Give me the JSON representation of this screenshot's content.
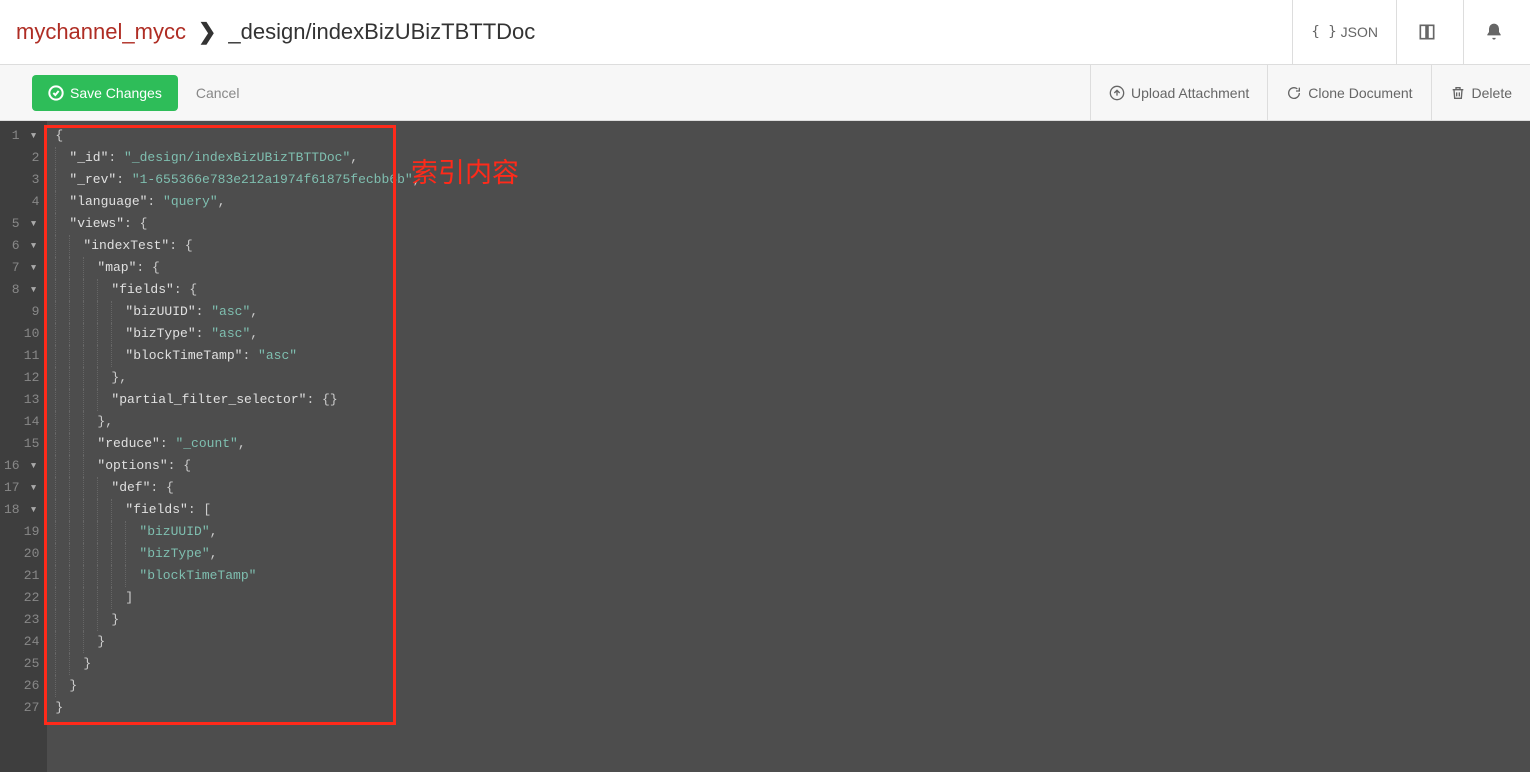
{
  "header": {
    "db_name": "mychannel_mycc",
    "doc_name": "_design/indexBizUBizTBTTDoc",
    "json_label": "JSON"
  },
  "toolbar": {
    "save_label": "Save Changes",
    "cancel_label": "Cancel",
    "upload_label": "Upload Attachment",
    "clone_label": "Clone Document",
    "delete_label": "Delete"
  },
  "annotation": "索引内容",
  "code_lines": [
    {
      "n": 1,
      "fold": true,
      "indent": 0,
      "tokens": [
        [
          "punc",
          "{"
        ]
      ]
    },
    {
      "n": 2,
      "fold": false,
      "indent": 1,
      "tokens": [
        [
          "key",
          "\"_id\""
        ],
        [
          "punc",
          ": "
        ],
        [
          "str",
          "\"_design/indexBizUBizTBTTDoc\""
        ],
        [
          "punc",
          ","
        ]
      ]
    },
    {
      "n": 3,
      "fold": false,
      "indent": 1,
      "tokens": [
        [
          "key",
          "\"_rev\""
        ],
        [
          "punc",
          ": "
        ],
        [
          "str",
          "\"1-655366e783e212a1974f61875fecbb6b\""
        ],
        [
          "punc",
          ","
        ]
      ]
    },
    {
      "n": 4,
      "fold": false,
      "indent": 1,
      "tokens": [
        [
          "key",
          "\"language\""
        ],
        [
          "punc",
          ": "
        ],
        [
          "str",
          "\"query\""
        ],
        [
          "punc",
          ","
        ]
      ]
    },
    {
      "n": 5,
      "fold": true,
      "indent": 1,
      "tokens": [
        [
          "key",
          "\"views\""
        ],
        [
          "punc",
          ": {"
        ]
      ]
    },
    {
      "n": 6,
      "fold": true,
      "indent": 2,
      "tokens": [
        [
          "key",
          "\"indexTest\""
        ],
        [
          "punc",
          ": {"
        ]
      ]
    },
    {
      "n": 7,
      "fold": true,
      "indent": 3,
      "tokens": [
        [
          "key",
          "\"map\""
        ],
        [
          "punc",
          ": {"
        ]
      ]
    },
    {
      "n": 8,
      "fold": true,
      "indent": 4,
      "tokens": [
        [
          "key",
          "\"fields\""
        ],
        [
          "punc",
          ": {"
        ]
      ]
    },
    {
      "n": 9,
      "fold": false,
      "indent": 5,
      "tokens": [
        [
          "key",
          "\"bizUUID\""
        ],
        [
          "punc",
          ": "
        ],
        [
          "str",
          "\"asc\""
        ],
        [
          "punc",
          ","
        ]
      ]
    },
    {
      "n": 10,
      "fold": false,
      "indent": 5,
      "tokens": [
        [
          "key",
          "\"bizType\""
        ],
        [
          "punc",
          ": "
        ],
        [
          "str",
          "\"asc\""
        ],
        [
          "punc",
          ","
        ]
      ]
    },
    {
      "n": 11,
      "fold": false,
      "indent": 5,
      "tokens": [
        [
          "key",
          "\"blockTimeTamp\""
        ],
        [
          "punc",
          ": "
        ],
        [
          "str",
          "\"asc\""
        ]
      ]
    },
    {
      "n": 12,
      "fold": false,
      "indent": 4,
      "tokens": [
        [
          "punc",
          "},"
        ]
      ]
    },
    {
      "n": 13,
      "fold": false,
      "indent": 4,
      "tokens": [
        [
          "key",
          "\"partial_filter_selector\""
        ],
        [
          "punc",
          ": {}"
        ]
      ]
    },
    {
      "n": 14,
      "fold": false,
      "indent": 3,
      "tokens": [
        [
          "punc",
          "},"
        ]
      ]
    },
    {
      "n": 15,
      "fold": false,
      "indent": 3,
      "tokens": [
        [
          "key",
          "\"reduce\""
        ],
        [
          "punc",
          ": "
        ],
        [
          "str",
          "\"_count\""
        ],
        [
          "punc",
          ","
        ]
      ]
    },
    {
      "n": 16,
      "fold": true,
      "indent": 3,
      "tokens": [
        [
          "key",
          "\"options\""
        ],
        [
          "punc",
          ": {"
        ]
      ]
    },
    {
      "n": 17,
      "fold": true,
      "indent": 4,
      "tokens": [
        [
          "key",
          "\"def\""
        ],
        [
          "punc",
          ": {"
        ]
      ]
    },
    {
      "n": 18,
      "fold": true,
      "indent": 5,
      "tokens": [
        [
          "key",
          "\"fields\""
        ],
        [
          "punc",
          ": ["
        ]
      ]
    },
    {
      "n": 19,
      "fold": false,
      "indent": 6,
      "tokens": [
        [
          "str",
          "\"bizUUID\""
        ],
        [
          "punc",
          ","
        ]
      ]
    },
    {
      "n": 20,
      "fold": false,
      "indent": 6,
      "tokens": [
        [
          "str",
          "\"bizType\""
        ],
        [
          "punc",
          ","
        ]
      ]
    },
    {
      "n": 21,
      "fold": false,
      "indent": 6,
      "tokens": [
        [
          "str",
          "\"blockTimeTamp\""
        ]
      ]
    },
    {
      "n": 22,
      "fold": false,
      "indent": 5,
      "tokens": [
        [
          "punc",
          "]"
        ]
      ]
    },
    {
      "n": 23,
      "fold": false,
      "indent": 4,
      "tokens": [
        [
          "punc",
          "}"
        ]
      ]
    },
    {
      "n": 24,
      "fold": false,
      "indent": 3,
      "tokens": [
        [
          "punc",
          "}"
        ]
      ]
    },
    {
      "n": 25,
      "fold": false,
      "indent": 2,
      "tokens": [
        [
          "punc",
          "}"
        ]
      ]
    },
    {
      "n": 26,
      "fold": false,
      "indent": 1,
      "tokens": [
        [
          "punc",
          "}"
        ]
      ]
    },
    {
      "n": 27,
      "fold": false,
      "indent": 0,
      "tokens": [
        [
          "punc",
          "}"
        ]
      ]
    }
  ]
}
